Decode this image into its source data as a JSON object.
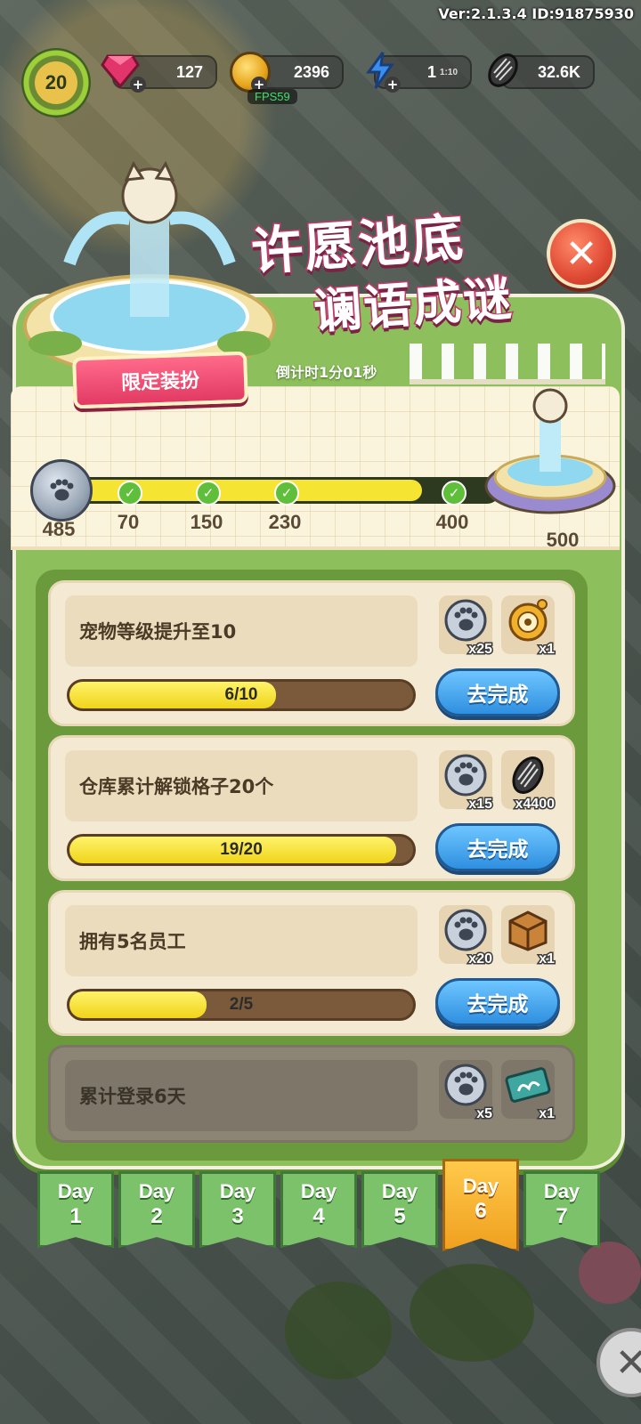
{
  "version": "Ver:2.1.3.4 ID:91875930",
  "hud": {
    "level": "20",
    "gems": "127",
    "coins": "2396",
    "energy": "1",
    "energy_timer": "1:10",
    "seeds": "32.6K",
    "fps": "FPS59"
  },
  "event": {
    "title_line1": "许愿池底",
    "title_line2": "谰语成谜",
    "limited_tag": "限定装扮",
    "countdown": "倒计时1分01秒"
  },
  "progress": {
    "current_points": "485",
    "fraction": 0.82,
    "milestones": [
      {
        "value": "70",
        "done": true
      },
      {
        "value": "150",
        "done": true
      },
      {
        "value": "230",
        "done": true
      },
      {
        "value": "400",
        "done": true
      },
      {
        "value": "500",
        "done": false
      }
    ]
  },
  "tasks": [
    {
      "desc": "宠物等级提升至10",
      "progress_text": "6/10",
      "progress": 0.6,
      "rewards": [
        {
          "icon": "paw-coin-icon",
          "qty": "x25"
        },
        {
          "icon": "compass-icon",
          "qty": "x1"
        }
      ],
      "button": "去完成"
    },
    {
      "desc": "仓库累计解锁格子20个",
      "progress_text": "19/20",
      "progress": 0.95,
      "rewards": [
        {
          "icon": "paw-coin-icon",
          "qty": "x15"
        },
        {
          "icon": "seed-icon",
          "qty": "x4400"
        }
      ],
      "button": "去完成"
    },
    {
      "desc": "拥有5名员工",
      "progress_text": "2/5",
      "progress": 0.4,
      "rewards": [
        {
          "icon": "paw-coin-icon",
          "qty": "x20"
        },
        {
          "icon": "crate-icon",
          "qty": "x1"
        }
      ],
      "button": "去完成"
    },
    {
      "desc": "累计登录6天",
      "rewards": [
        {
          "icon": "paw-coin-icon",
          "qty": "x5"
        },
        {
          "icon": "ticket-icon",
          "qty": "x1"
        }
      ]
    }
  ],
  "days": [
    {
      "label": "Day",
      "num": "1"
    },
    {
      "label": "Day",
      "num": "2"
    },
    {
      "label": "Day",
      "num": "3"
    },
    {
      "label": "Day",
      "num": "4"
    },
    {
      "label": "Day",
      "num": "5"
    },
    {
      "label": "Day",
      "num": "6",
      "active": true
    },
    {
      "label": "Day",
      "num": "7"
    }
  ],
  "colors": {
    "panel_green": "#8dbf5c",
    "button_blue": "#2f8fe0",
    "progress_yellow": "#f5e532",
    "active_day": "#f0a020",
    "title_pink": "#c23a6a"
  }
}
